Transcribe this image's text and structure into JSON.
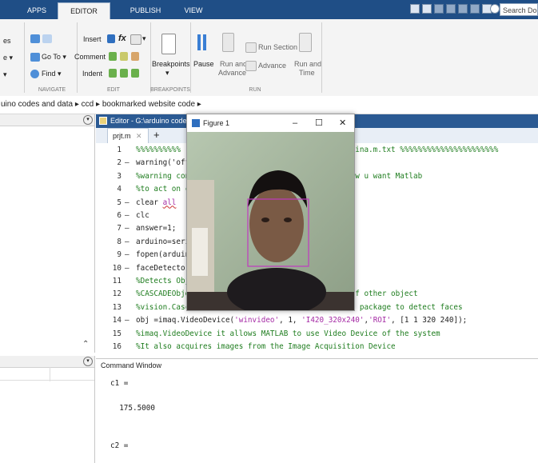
{
  "tabs": [
    "APPS",
    "EDITOR",
    "PUBLISH",
    "VIEW"
  ],
  "search": {
    "placeholder": "Search Docu"
  },
  "ribbon": {
    "file_partial": [
      "es",
      "e ▾",
      "▾"
    ],
    "navigate": {
      "goto": "Go To ▾",
      "find": "Find ▾",
      "label": "NAVIGATE"
    },
    "edit": {
      "insert": "Insert",
      "fx": "fx",
      "comment": "Comment",
      "indent": "Indent",
      "label": "EDIT"
    },
    "breakpoints": {
      "button": "Breakpoints",
      "arrow": "▾",
      "label": "BREAKPOINTS"
    },
    "run": {
      "pause": "Pause",
      "run_advance_1": "Run and",
      "run_advance_2": "Advance",
      "run_section": "Run Section",
      "advance": "Advance",
      "run_time_1": "Run and",
      "run_time_2": "Time",
      "label": "RUN"
    }
  },
  "breadcrumb": [
    "uino codes and data",
    "ccd",
    "bookmarked website code"
  ],
  "editor": {
    "title": "Editor - G:\\arduino codes a",
    "tab": "prjt.m",
    "add_tab": "+",
    "lines": [
      {
        "n": "1",
        "dash": "",
        "code": "%%%%%%%%%%                                     maina.m.txt %%%%%%%%%%%%%%%%%%%%%%",
        "cls": "cmt"
      },
      {
        "n": "2",
        "dash": "–",
        "code": "warning('off                                 )",
        "cls": "mix"
      },
      {
        "n": "3",
        "dash": "",
        "code": "%warning con                                 e how u want Matlab",
        "cls": "cmt"
      },
      {
        "n": "4",
        "dash": "",
        "code": "%to act on c",
        "cls": "cmt"
      },
      {
        "n": "5",
        "dash": "–",
        "code": "clear all",
        "cls": "clear"
      },
      {
        "n": "6",
        "dash": "–",
        "code": "clc",
        "cls": ""
      },
      {
        "n": "7",
        "dash": "–",
        "code": "answer=1;",
        "cls": ""
      },
      {
        "n": "8",
        "dash": "–",
        "code": "arduino=seri",
        "cls": ""
      },
      {
        "n": "9",
        "dash": "–",
        "code": "fopen(arduin",
        "cls": ""
      },
      {
        "n": "10",
        "dash": "–",
        "code": "faceDetector",
        "cls": ""
      },
      {
        "n": "11",
        "dash": "",
        "code": "%Detects Obj",
        "cls": "cmt"
      },
      {
        "n": "12",
        "dash": "",
        "code": "%CASCADEObje                                 on of other object",
        "cls": "cmt"
      },
      {
        "n": "13",
        "dash": "",
        "code": "%vision.CascadeObjectDetector() is a funtion or a package to detect faces",
        "cls": "cmt"
      },
      {
        "n": "14",
        "dash": "–",
        "code": "obj =imaq.VideoDevice('winvideo', 1, 'I420_320x240','ROI', [1 1 320 240]);",
        "cls": "obj"
      },
      {
        "n": "15",
        "dash": "",
        "code": "%imaq.VideoDevice it allows MATLAB to use Video Device of the system",
        "cls": "cmt"
      },
      {
        "n": "16",
        "dash": "",
        "code": "%It also acquires images from the Image Acquisition Device",
        "cls": "cmt"
      }
    ]
  },
  "command_window": {
    "title": "Command Window",
    "lines": [
      "c1 =",
      "",
      "  175.5000",
      "",
      "",
      "c2 ="
    ]
  },
  "figure": {
    "title": "Figure 1",
    "minimize": "–",
    "maximize": "☐",
    "close": "✕"
  },
  "colors": {
    "tabstrip": "#1f4e86",
    "editor_title": "#2b5a93",
    "comment": "#1f7d1f",
    "string": "#a52ba5",
    "detect_box": "#c03ac0"
  }
}
